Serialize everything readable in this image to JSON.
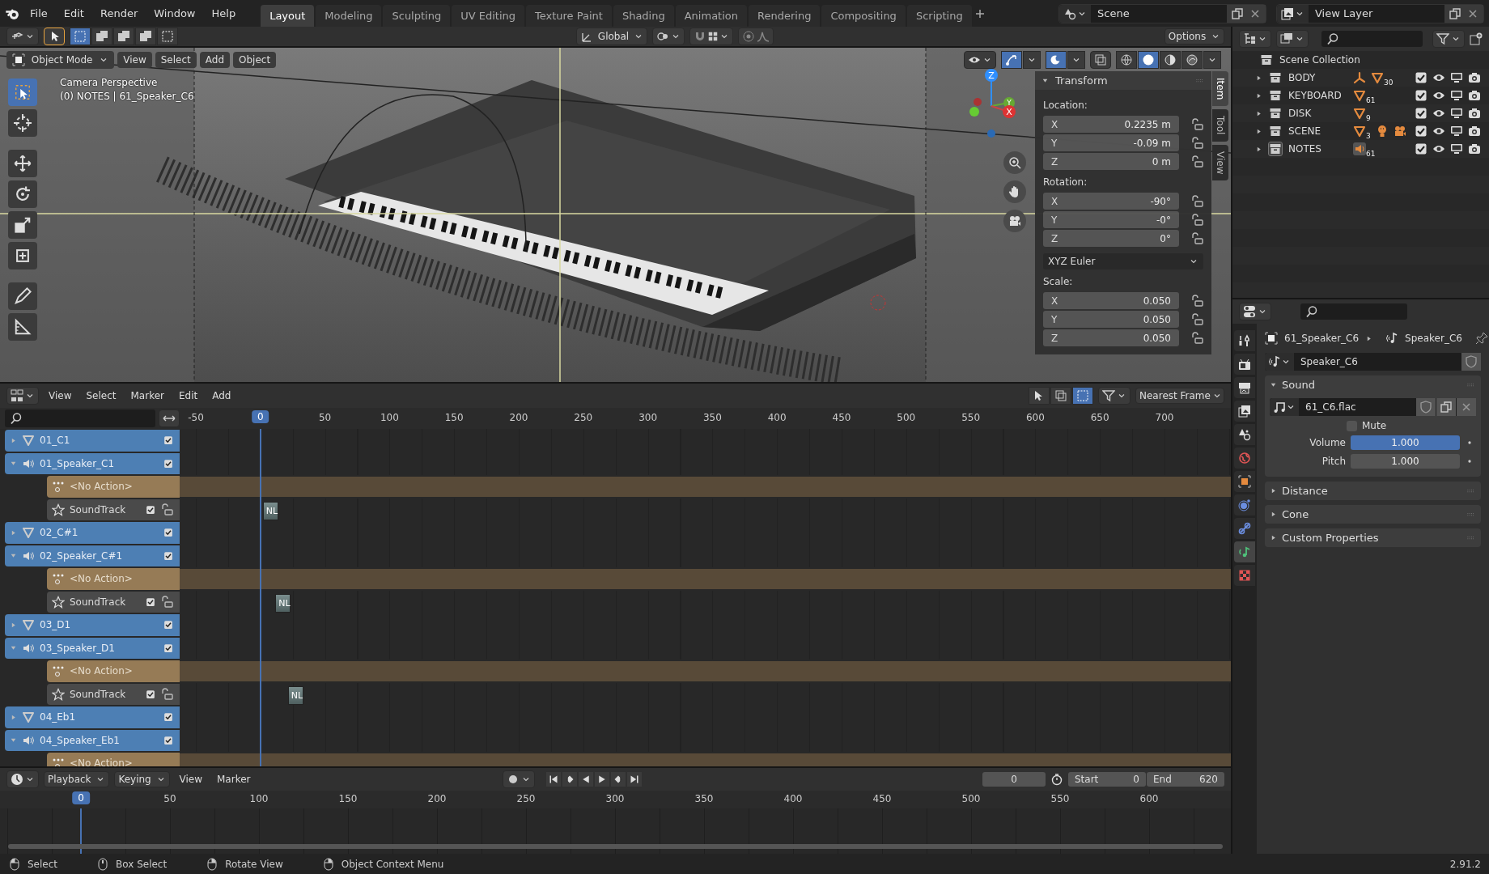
{
  "menu": [
    "File",
    "Edit",
    "Render",
    "Window",
    "Help"
  ],
  "workspaces": [
    {
      "label": "Layout",
      "selected": true
    },
    {
      "label": "Modeling",
      "selected": false
    },
    {
      "label": "Sculpting",
      "selected": false
    },
    {
      "label": "UV Editing",
      "selected": false
    },
    {
      "label": "Texture Paint",
      "selected": false
    },
    {
      "label": "Shading",
      "selected": false
    },
    {
      "label": "Animation",
      "selected": false
    },
    {
      "label": "Rendering",
      "selected": false
    },
    {
      "label": "Compositing",
      "selected": false
    },
    {
      "label": "Scripting",
      "selected": false
    }
  ],
  "scene": "Scene",
  "view_layer": "View Layer",
  "viewport_header": {
    "orientation": "Global",
    "options": "Options"
  },
  "viewport": {
    "mode": "Object Mode",
    "menus": [
      "View",
      "Select",
      "Add",
      "Object"
    ],
    "camera": "Camera Perspective",
    "object_info": "(0) NOTES | 61_Speaker_C6",
    "gizmo_axes": [
      "Z",
      "Y",
      "X"
    ],
    "side_tabs": [
      {
        "label": "Item",
        "selected": true
      },
      {
        "label": "Tool",
        "selected": false
      },
      {
        "label": "View",
        "selected": false
      }
    ],
    "transform": {
      "title": "Transform",
      "location_label": "Location:",
      "location": [
        {
          "axis": "X",
          "value": "0.2235 m"
        },
        {
          "axis": "Y",
          "value": "-0.09 m"
        },
        {
          "axis": "Z",
          "value": "0 m"
        }
      ],
      "rotation_label": "Rotation:",
      "rotation": [
        {
          "axis": "X",
          "value": "-90°"
        },
        {
          "axis": "Y",
          "value": "-0°"
        },
        {
          "axis": "Z",
          "value": "0°"
        }
      ],
      "rotation_mode": "XYZ Euler",
      "scale_label": "Scale:",
      "scale": [
        {
          "axis": "X",
          "value": "0.050"
        },
        {
          "axis": "Y",
          "value": "0.050"
        },
        {
          "axis": "Z",
          "value": "0.050"
        }
      ]
    }
  },
  "outliner": {
    "root": "Scene Collection",
    "collections": [
      {
        "name": "BODY",
        "checked": true,
        "selected": false,
        "contents": [
          {
            "kind": "armature"
          },
          {
            "kind": "mesh",
            "count": "30"
          }
        ]
      },
      {
        "name": "KEYBOARD",
        "checked": true,
        "selected": false,
        "contents": [
          {
            "kind": "mesh",
            "count": "61"
          }
        ]
      },
      {
        "name": "DISK",
        "checked": true,
        "selected": false,
        "contents": [
          {
            "kind": "mesh",
            "count": "9"
          }
        ]
      },
      {
        "name": "SCENE",
        "checked": true,
        "selected": false,
        "contents": [
          {
            "kind": "mesh",
            "count": "3"
          },
          {
            "kind": "light"
          },
          {
            "kind": "camera"
          }
        ]
      },
      {
        "name": "NOTES",
        "checked": true,
        "selected": true,
        "contents": [
          {
            "kind": "speaker",
            "count": "61"
          }
        ]
      }
    ]
  },
  "properties": {
    "tabs": [
      {
        "kind": "tool",
        "selected": false
      },
      {
        "kind": "render",
        "selected": false
      },
      {
        "kind": "output",
        "selected": false
      },
      {
        "kind": "view_layer",
        "selected": false
      },
      {
        "kind": "scene",
        "selected": false
      },
      {
        "kind": "world",
        "selected": false
      },
      {
        "kind": "object",
        "selected": false
      },
      {
        "kind": "physics",
        "selected": false
      },
      {
        "kind": "constraints",
        "selected": false
      },
      {
        "kind": "data",
        "selected": true
      },
      {
        "kind": "texture",
        "selected": false
      }
    ],
    "object": "61_Speaker_C6",
    "data": "Speaker_C6",
    "datablock": "Speaker_C6",
    "sound_panel": {
      "title": "Sound",
      "expanded": true,
      "file": "61_C6.flac",
      "mute": {
        "label": "Mute",
        "checked": false
      },
      "fields": [
        {
          "label": "Volume",
          "value": "1.000",
          "selected": true
        },
        {
          "label": "Pitch",
          "value": "1.000",
          "selected": false
        }
      ]
    },
    "panels": [
      {
        "title": "Distance",
        "expanded": false
      },
      {
        "title": "Cone",
        "expanded": false
      },
      {
        "title": "Custom Properties",
        "expanded": false
      }
    ]
  },
  "nla": {
    "menus": [
      "View",
      "Select",
      "Marker",
      "Edit",
      "Add"
    ],
    "snap": "Nearest Frame",
    "ticks": [
      "-50",
      "50",
      "100",
      "150",
      "200",
      "250",
      "300",
      "350",
      "400",
      "450",
      "500",
      "550",
      "600",
      "650",
      "700"
    ],
    "current_frame": "0",
    "channels": [
      {
        "kind": "object",
        "name": "01_C1",
        "expanded": false,
        "checked": true
      },
      {
        "kind": "speaker",
        "name": "01_Speaker_C1",
        "expanded": true,
        "checked": true
      },
      {
        "kind": "action",
        "name": "<No Action>"
      },
      {
        "kind": "track",
        "name": "SoundTrack",
        "checked": true,
        "strip": "NL"
      },
      {
        "kind": "object",
        "name": "02_C#1",
        "expanded": false,
        "checked": true
      },
      {
        "kind": "speaker",
        "name": "02_Speaker_C#1",
        "expanded": true,
        "checked": true
      },
      {
        "kind": "action",
        "name": "<No Action>"
      },
      {
        "kind": "track",
        "name": "SoundTrack",
        "checked": true,
        "strip": "NL"
      },
      {
        "kind": "object",
        "name": "03_D1",
        "expanded": false,
        "checked": true
      },
      {
        "kind": "speaker",
        "name": "03_Speaker_D1",
        "expanded": true,
        "checked": true
      },
      {
        "kind": "action",
        "name": "<No Action>"
      },
      {
        "kind": "track",
        "name": "SoundTrack",
        "checked": true,
        "strip": "NL"
      },
      {
        "kind": "object",
        "name": "04_Eb1",
        "expanded": false,
        "checked": true
      },
      {
        "kind": "speaker",
        "name": "04_Speaker_Eb1",
        "expanded": true,
        "checked": true
      },
      {
        "kind": "action",
        "name": "<No Action>"
      }
    ]
  },
  "timeline": {
    "menus": [
      {
        "label": "Playback",
        "dropdown": true
      },
      {
        "label": "Keying",
        "dropdown": true
      },
      {
        "label": "View",
        "dropdown": false
      },
      {
        "label": "Marker",
        "dropdown": false
      }
    ],
    "frame": "0",
    "start_label": "Start",
    "start": "0",
    "end_label": "End",
    "end": "620",
    "ticks": [
      "50",
      "100",
      "150",
      "200",
      "250",
      "300",
      "350",
      "400",
      "450",
      "500",
      "550",
      "600"
    ],
    "current_frame": "0"
  },
  "status_bar": {
    "hints": [
      "Select",
      "Box Select",
      "Rotate View",
      "Object Context Menu"
    ],
    "version": "2.91.2"
  }
}
